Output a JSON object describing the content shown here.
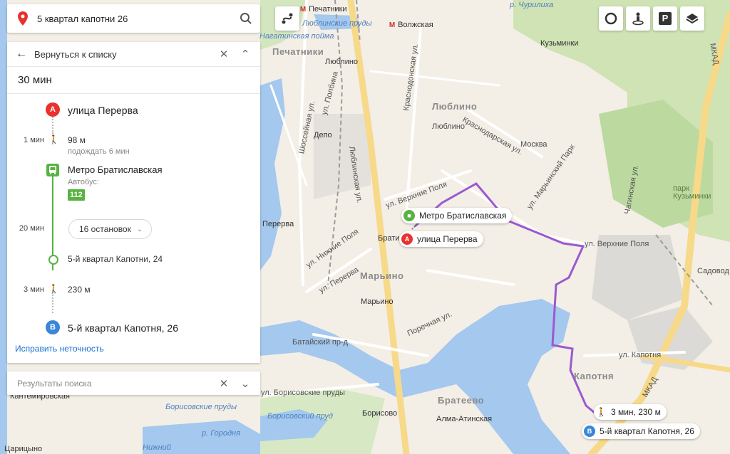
{
  "search": {
    "query": "5 квартал капотни 26"
  },
  "panel": {
    "back_label": "Вернуться к списку",
    "duration": "30 мин",
    "start": {
      "letter": "A",
      "name": "улица Перерва"
    },
    "walk1": {
      "time": "1 мин",
      "distance": "98 м",
      "note": "подождать 6 мин"
    },
    "bus_stop": {
      "name": "Метро Братиславская",
      "mode": "Автобус:",
      "route": "112"
    },
    "ride": {
      "time": "20 мин",
      "stops": "16 остановок"
    },
    "alight": {
      "name": "5-й квартал Капотни, 24"
    },
    "walk2": {
      "time": "3 мин",
      "distance": "230 м"
    },
    "end": {
      "letter": "B",
      "name": "5-й квартал Капотня, 26"
    },
    "fix_link": "Исправить неточность"
  },
  "results": {
    "label": "Результаты поиска"
  },
  "controls": {
    "parking": "P"
  },
  "map_chips": {
    "bus_stop": "Метро Братиславская",
    "point_a": {
      "letter": "A",
      "name": "улица Перерва"
    },
    "walk": "3 мин, 230 м",
    "point_b": {
      "letter": "B",
      "name": "5-й квартал Капотня, 26"
    }
  },
  "map_labels": {
    "districts": [
      "Печатники",
      "Люблино",
      "Марьино",
      "Капотня",
      "Братеево"
    ],
    "metro": [
      "Печатники",
      "Волжская",
      "Люблино",
      "Марьино",
      "Борисово",
      "Алма-Атинская",
      "Кантемировская",
      "Царицыно",
      "Перерва",
      "Депо",
      "Кузьминки",
      "Братиславская"
    ],
    "places": [
      "Москва",
      "Садовод",
      "Люблино",
      "Печатники",
      "Кузьминки"
    ],
    "roads": [
      "Люблинская ул.",
      "Краснодонская ул.",
      "Шоссейная ул.",
      "ул. Полбина",
      "Краснодарская ул.",
      "ул. Марьинский Парк",
      "ул. Верхние Поля",
      "ул. Нижние Поля",
      "ул. Перерва",
      "Батайский пр-д",
      "Поречная ул.",
      "ул. Борисовские пруды",
      "ул. Капотня",
      "МКАД",
      "Чагинская ул."
    ],
    "water": [
      "р. Чурилиха",
      "Люблинские пруды",
      "Нагатинская пойма",
      "Борисовские пруды",
      "Борисовский пруд",
      "р. Городня",
      "Нижний"
    ],
    "parks": [
      "парк Кузьминки"
    ]
  }
}
